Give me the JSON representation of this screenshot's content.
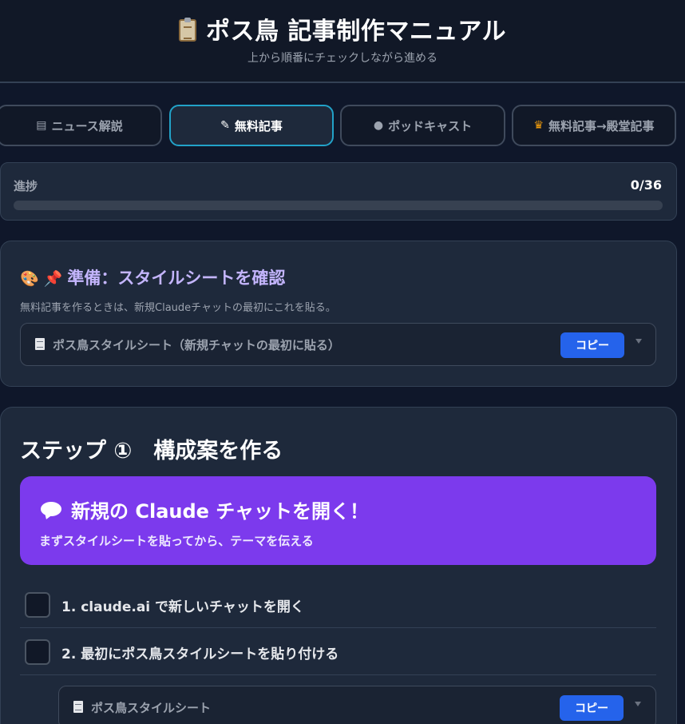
{
  "header": {
    "title": "ポス鳥 記事制作マニュアル",
    "subtitle": "上から順番にチェックしながら進める"
  },
  "tabs": [
    {
      "label": "ニュース解説",
      "icon": "newspaper-icon",
      "active": false
    },
    {
      "label": "無料記事",
      "icon": "memo-icon",
      "active": true
    },
    {
      "label": "ポッドキャスト",
      "icon": "microphone-icon",
      "active": false
    },
    {
      "label": "無料記事→殿堂記事",
      "icon": "trophy-icon",
      "active": false
    }
  ],
  "progress": {
    "label": "進捗",
    "count": "0/36",
    "completed": 0,
    "total": 36
  },
  "prep": {
    "icons": [
      "palette-icon",
      "pushpin-icon"
    ],
    "title": "準備：スタイルシートを確認",
    "description": "無料記事を作るときは、新規Claudeチャットの最初にこれを貼る。",
    "sheet_label": "ポス鳥スタイルシート（新規チャットの最初に貼る）",
    "copy_label": "コピー"
  },
  "step1": {
    "title": "ステップ ①　構成案を作る",
    "banner": {
      "title": "新規の Claude チャットを開く！",
      "subtitle": "まずスタイルシートを貼ってから、テーマを伝える"
    },
    "items": [
      {
        "label": "1. claude.ai で新しいチャットを開く",
        "checked": false
      },
      {
        "label": "2. 最初にポス鳥スタイルシートを貼り付ける",
        "checked": false
      }
    ],
    "sheet_label": "ポス鳥スタイルシート",
    "copy_label": "コピー"
  },
  "colors": {
    "background": "#0f172a",
    "card": "#1e293b",
    "active_tab_border": "#22a2c8",
    "banner": "#7c3aed",
    "copy_button": "#2563eb",
    "prep_title": "#c4b5fd"
  }
}
